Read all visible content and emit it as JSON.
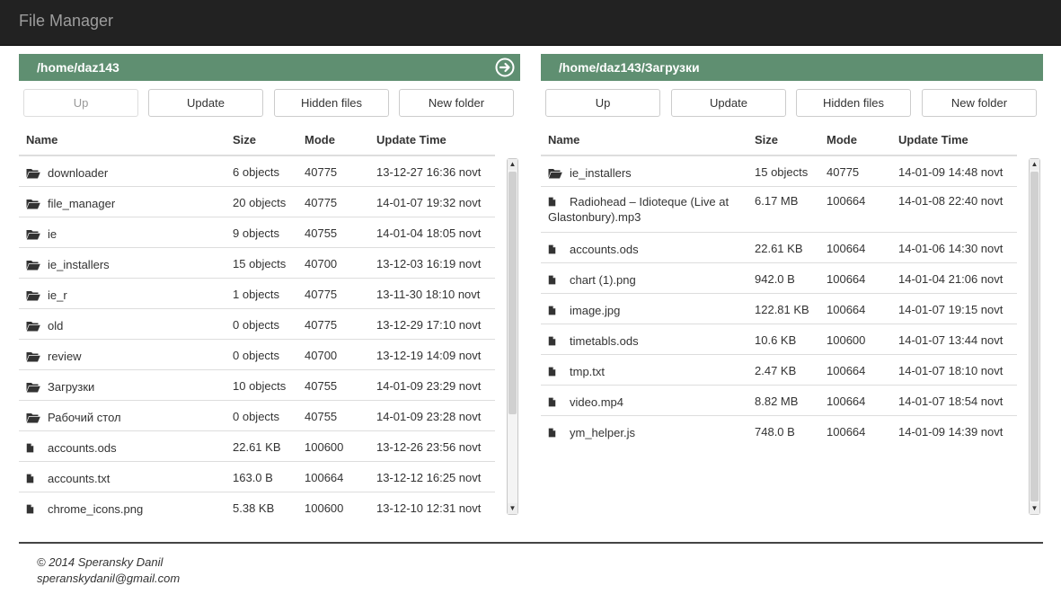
{
  "app": {
    "title": "File Manager"
  },
  "columns": {
    "name": "Name",
    "size": "Size",
    "mode": "Mode",
    "time": "Update Time"
  },
  "buttons": {
    "up": "Up",
    "update": "Update",
    "hidden": "Hidden files",
    "new_folder": "New folder"
  },
  "left": {
    "path": "/home/daz143",
    "up_disabled": true,
    "rows": [
      {
        "type": "folder",
        "name": "downloader",
        "size": "6 objects",
        "mode": "40775",
        "time": "13-12-27 16:36 novt"
      },
      {
        "type": "folder",
        "name": "file_manager",
        "size": "20 objects",
        "mode": "40775",
        "time": "14-01-07 19:32 novt"
      },
      {
        "type": "folder",
        "name": "ie",
        "size": "9 objects",
        "mode": "40755",
        "time": "14-01-04 18:05 novt"
      },
      {
        "type": "folder",
        "name": "ie_installers",
        "size": "15 objects",
        "mode": "40700",
        "time": "13-12-03 16:19 novt"
      },
      {
        "type": "folder",
        "name": "ie_r",
        "size": "1 objects",
        "mode": "40775",
        "time": "13-11-30 18:10 novt"
      },
      {
        "type": "folder",
        "name": "old",
        "size": "0 objects",
        "mode": "40775",
        "time": "13-12-29 17:10 novt"
      },
      {
        "type": "folder",
        "name": "review",
        "size": "0 objects",
        "mode": "40700",
        "time": "13-12-19 14:09 novt"
      },
      {
        "type": "folder",
        "name": "Загрузки",
        "size": "10 objects",
        "mode": "40755",
        "time": "14-01-09 23:29 novt"
      },
      {
        "type": "folder",
        "name": "Рабочий стол",
        "size": "0 objects",
        "mode": "40755",
        "time": "14-01-09 23:28 novt"
      },
      {
        "type": "file",
        "name": "accounts.ods",
        "size": "22.61 KB",
        "mode": "100600",
        "time": "13-12-26 23:56 novt"
      },
      {
        "type": "file",
        "name": "accounts.txt",
        "size": "163.0 B",
        "mode": "100664",
        "time": "13-12-12 16:25 novt"
      },
      {
        "type": "file",
        "name": "chrome_icons.png",
        "size": "5.38 KB",
        "mode": "100600",
        "time": "13-12-10 12:31 novt"
      }
    ]
  },
  "right": {
    "path": "/home/daz143/Загрузки",
    "up_disabled": false,
    "rows": [
      {
        "type": "folder",
        "name": "ie_installers",
        "size": "15 objects",
        "mode": "40775",
        "time": "14-01-09 14:48 novt"
      },
      {
        "type": "file",
        "name": "Radiohead – Idioteque (Live at Glastonbury).mp3",
        "size": "6.17 MB",
        "mode": "100664",
        "time": "14-01-08 22:40 novt"
      },
      {
        "type": "file",
        "name": "accounts.ods",
        "size": "22.61 KB",
        "mode": "100664",
        "time": "14-01-06 14:30 novt"
      },
      {
        "type": "file",
        "name": "chart (1).png",
        "size": "942.0 B",
        "mode": "100664",
        "time": "14-01-04 21:06 novt"
      },
      {
        "type": "file",
        "name": "image.jpg",
        "size": "122.81 KB",
        "mode": "100664",
        "time": "14-01-07 19:15 novt"
      },
      {
        "type": "file",
        "name": "timetabls.ods",
        "size": "10.6 KB",
        "mode": "100600",
        "time": "14-01-07 13:44 novt"
      },
      {
        "type": "file",
        "name": "tmp.txt",
        "size": "2.47 KB",
        "mode": "100664",
        "time": "14-01-07 18:10 novt"
      },
      {
        "type": "file",
        "name": "video.mp4",
        "size": "8.82 MB",
        "mode": "100664",
        "time": "14-01-07 18:54 novt"
      },
      {
        "type": "file",
        "name": "ym_helper.js",
        "size": "748.0 B",
        "mode": "100664",
        "time": "14-01-09 14:39 novt"
      }
    ]
  },
  "footer": {
    "copyright": "© 2014 Speransky Danil",
    "email": "speranskydanil@gmail.com"
  },
  "colors": {
    "path_bar": "#5f8f71",
    "navbar": "#222222"
  }
}
